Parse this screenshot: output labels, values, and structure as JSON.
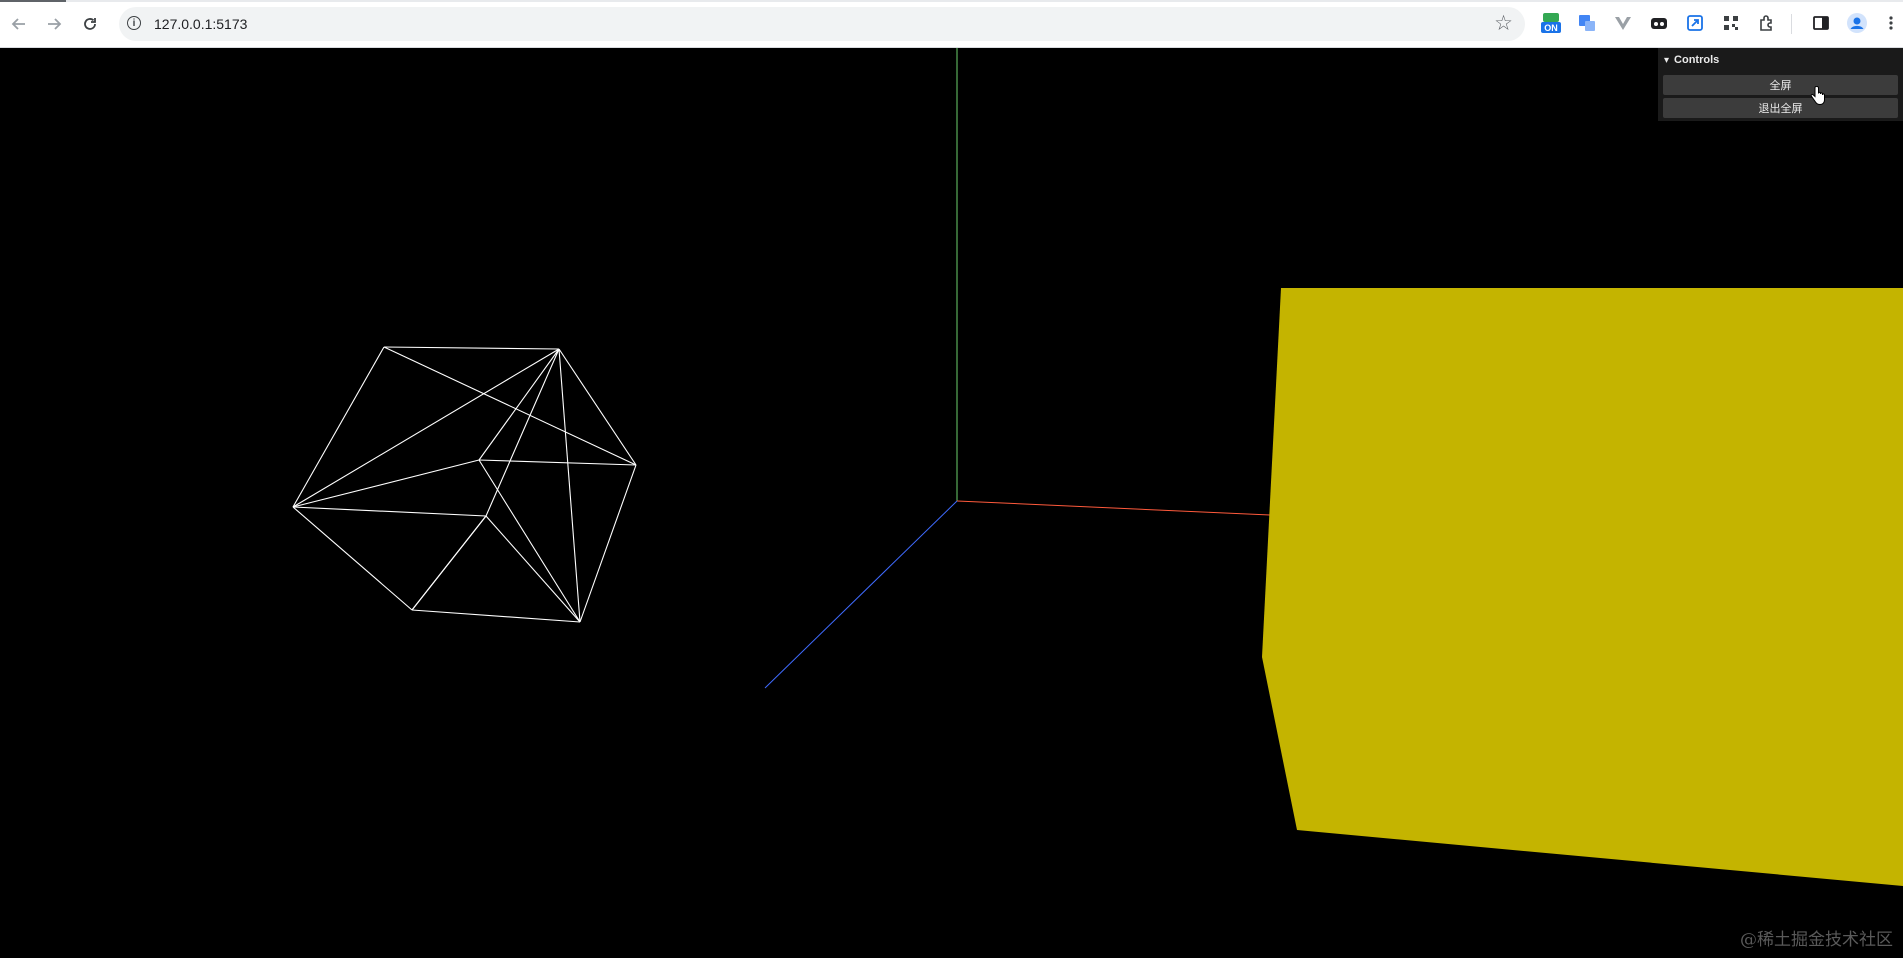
{
  "browser": {
    "url": "127.0.0.1:5173",
    "ext_on_badge": "ON"
  },
  "gui": {
    "title": "Controls",
    "fullscreen_label": "全屏",
    "exit_fullscreen_label": "退出全屏"
  },
  "scene": {
    "background": "#000000",
    "wireframe_color": "#ffffff",
    "cube_color": "#c4b400",
    "axis_x_color": "#ff5a3c",
    "axis_y_color": "#6ccf6c",
    "axis_z_color": "#3f6bff"
  },
  "watermark": "@稀土掘金技术社区"
}
